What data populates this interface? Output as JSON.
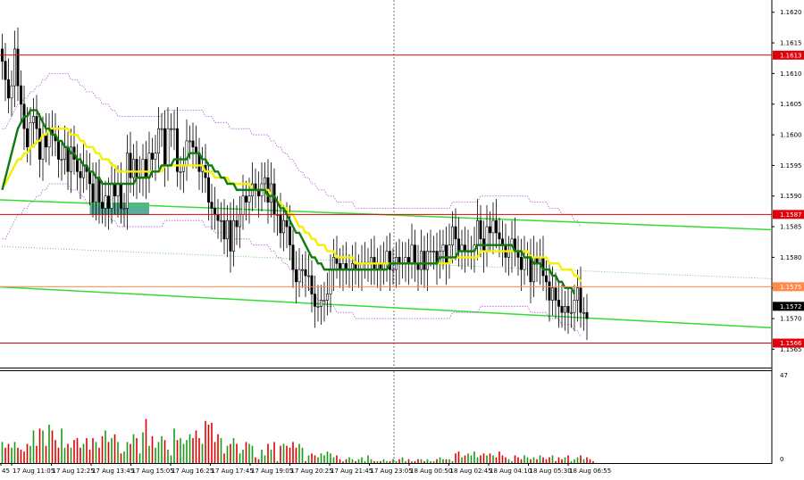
{
  "chart_data": {
    "type": "candlestick",
    "instrument_timeframe": "",
    "title": "",
    "price_axis": {
      "range": [
        1.1562,
        1.1622
      ],
      "ticks": [
        "1.1620",
        "1.1615",
        "1.1610",
        "1.1605",
        "1.1600",
        "1.1595",
        "1.1590",
        "1.1585",
        "1.1580",
        "1.1575",
        "1.1570",
        "1.1565"
      ]
    },
    "time_axis": {
      "labels": [
        "45",
        "17 Aug 11:05",
        "17 Aug 12:25",
        "17 Aug 13:45",
        "17 Aug 15:05",
        "17 Aug 16:25",
        "17 Aug 17:45",
        "17 Aug 19:05",
        "17 Aug 20:25",
        "17 Aug 21:45",
        "17 Aug 23:05",
        "18 Aug 00:50",
        "18 Aug 02:45",
        "18 Aug 04:10",
        "18 Aug 05:30",
        "18 Aug 06:55"
      ]
    },
    "horizontal_levels": [
      {
        "price": 1.1613,
        "label": "1.1613",
        "color": "#e0000a"
      },
      {
        "price": 1.1587,
        "label": "1.1587",
        "color": "#e0000a"
      },
      {
        "price": 1.15752,
        "label": "1.1575",
        "color": "#ff8a4a"
      },
      {
        "price": 1.1566,
        "label": "1.1566",
        "color": "#e0000a"
      }
    ],
    "current_price": {
      "price": 1.1572,
      "label": "1.1572"
    },
    "trend_lines": [
      {
        "name": "upper channel",
        "from": [
          1,
          1.15894
        ],
        "to": [
          191,
          1.15845
        ],
        "color": "#33dd33"
      },
      {
        "name": "lower channel",
        "from": [
          1,
          1.15752
        ],
        "to": [
          191,
          1.15685
        ],
        "color": "#33dd33"
      },
      {
        "name": "mid channel (dotted)",
        "from": [
          1,
          1.15818
        ],
        "to": [
          191,
          1.15765
        ],
        "color": "#66cc66",
        "dotted": true
      }
    ],
    "highlight_box": {
      "from_bar": 28,
      "to_bar": 47,
      "price_from": 1.15865,
      "price_to": 1.15885,
      "color": "#3aa08a"
    },
    "candles_close": [
      1.1612,
      1.1609,
      1.1606,
      1.1608,
      1.1614,
      1.1608,
      1.1605,
      1.1601,
      1.1598,
      1.1602,
      1.1603,
      1.1601,
      1.1596,
      1.16,
      1.1598,
      1.1601,
      1.16,
      1.1599,
      1.1596,
      1.1596,
      1.1598,
      1.1594,
      1.1598,
      1.1596,
      1.1594,
      1.1593,
      1.1595,
      1.1594,
      1.1592,
      1.1589,
      1.1593,
      1.1589,
      1.1588,
      1.159,
      1.1588,
      1.1592,
      1.159,
      1.1592,
      1.1588,
      1.1588,
      1.1597,
      1.1593,
      1.1596,
      1.1593,
      1.1593,
      1.1596,
      1.1593,
      1.1597,
      1.1596,
      1.1597,
      1.1601,
      1.1601,
      1.1595,
      1.1601,
      1.1601,
      1.1601,
      1.1594,
      1.1594,
      1.1595,
      1.1599,
      1.1599,
      1.1598,
      1.1597,
      1.1594,
      1.1595,
      1.1593,
      1.1589,
      1.1588,
      1.1587,
      1.1586,
      1.1586,
      1.1583,
      1.1586,
      1.1581,
      1.1586,
      1.1585,
      1.1587,
      1.159,
      1.1589,
      1.159,
      1.1592,
      1.1591,
      1.159,
      1.1592,
      1.1593,
      1.1589,
      1.1592,
      1.1587,
      1.1587,
      1.1584,
      1.1586,
      1.1585,
      1.1582,
      1.1578,
      1.1576,
      1.1578,
      1.1578,
      1.1577,
      1.1577,
      1.1574,
      1.1572,
      1.1572,
      1.1573,
      1.1573,
      1.1574,
      1.1578,
      1.158,
      1.1579,
      1.1578,
      1.1579,
      1.1578,
      1.1578,
      1.1579,
      1.1578,
      1.1578,
      1.1579,
      1.1579,
      1.1579,
      1.158,
      1.1578,
      1.1579,
      1.1578,
      1.1579,
      1.1581,
      1.1578,
      1.1578,
      1.158,
      1.1579,
      1.1579,
      1.158,
      1.1579,
      1.1582,
      1.1579,
      1.1578,
      1.1581,
      1.1578,
      1.1581,
      1.1581,
      1.1581,
      1.1579,
      1.1581,
      1.1582,
      1.1579,
      1.1582,
      1.1585,
      1.1583,
      1.1581,
      1.1582,
      1.1581,
      1.1581,
      1.1581,
      1.1582,
      1.1586,
      1.1583,
      1.1581,
      1.1585,
      1.1584,
      1.1586,
      1.1584,
      1.1583,
      1.1582,
      1.158,
      1.1581,
      1.1583,
      1.1581,
      1.158,
      1.1578,
      1.158,
      1.158,
      1.1576,
      1.158,
      1.1579,
      1.158,
      1.1577,
      1.1576,
      1.1573,
      1.1575,
      1.1573,
      1.1572,
      1.1571,
      1.1572,
      1.1571,
      1.1571,
      1.1573,
      1.1575,
      1.1571,
      1.1571,
      1.157
    ],
    "ema_green": [
      1.1591,
      1.1593,
      1.1595,
      1.1597,
      1.1599,
      1.1601,
      1.1602,
      1.1603,
      1.1603,
      1.1604,
      1.1604,
      1.1604,
      1.1603,
      1.1602,
      1.1601,
      1.1601,
      1.16,
      1.16,
      1.1599,
      1.1599,
      1.1598,
      1.1598,
      1.1597,
      1.1597,
      1.1596,
      1.1596,
      1.1595,
      1.1595,
      1.1594,
      1.1594,
      1.1593,
      1.1593,
      1.1592,
      1.1592,
      1.1592,
      1.1592,
      1.1592,
      1.1592,
      1.1592,
      1.1592,
      1.1592,
      1.1592,
      1.1592,
      1.1593,
      1.1593,
      1.1593,
      1.1593,
      1.1593,
      1.1594,
      1.1594,
      1.1594,
      1.1595,
      1.1595,
      1.1595,
      1.1595,
      1.1596,
      1.1596,
      1.1596,
      1.1596,
      1.1596,
      1.1597,
      1.1597,
      1.1597,
      1.1597,
      1.1596,
      1.1596,
      1.1595,
      1.1595,
      1.1594,
      1.1594,
      1.1593,
      1.1593,
      1.1592,
      1.1592,
      1.1592,
      1.1591,
      1.1591,
      1.1591,
      1.1591,
      1.1591,
      1.1591,
      1.1591,
      1.1591,
      1.1591,
      1.1591,
      1.159,
      1.159,
      1.159,
      1.1589,
      1.1588,
      1.1588,
      1.1587,
      1.1586,
      1.1585,
      1.1584,
      1.1584,
      1.1583,
      1.1582,
      1.1581,
      1.158,
      1.158,
      1.1579,
      1.1579,
      1.1578,
      1.1578,
      1.1578,
      1.1578,
      1.1578,
      1.1578,
      1.1578,
      1.1578,
      1.1578,
      1.1578,
      1.1578,
      1.1578,
      1.1578,
      1.1578,
      1.1578,
      1.1578,
      1.1578,
      1.1578,
      1.1578,
      1.1578,
      1.1578,
      1.1579,
      1.1579,
      1.1579,
      1.1579,
      1.1579,
      1.1579,
      1.1579,
      1.1579,
      1.1579,
      1.1579,
      1.1579,
      1.1579,
      1.1579,
      1.1579,
      1.1579,
      1.1579,
      1.158,
      1.158,
      1.158,
      1.158,
      1.158,
      1.158,
      1.1581,
      1.1581,
      1.1581,
      1.1581,
      1.1581,
      1.1581,
      1.1582,
      1.1582,
      1.1582,
      1.1582,
      1.1582,
      1.1582,
      1.1582,
      1.1582,
      1.1582,
      1.1582,
      1.1582,
      1.1582,
      1.1581,
      1.1581,
      1.1581,
      1.158,
      1.158,
      1.158,
      1.1579,
      1.1579,
      1.1579,
      1.1578,
      1.1578,
      1.1578,
      1.1577,
      1.1577,
      1.1576,
      1.1576,
      1.1575,
      1.1575,
      1.1575,
      1.1574
    ],
    "sma_yellow": [
      1.1592,
      1.1592,
      1.1593,
      1.1594,
      1.1595,
      1.1596,
      1.1596,
      1.1597,
      1.1597,
      1.1598,
      1.1598,
      1.1599,
      1.1599,
      1.16,
      1.16,
      1.1601,
      1.1601,
      1.1601,
      1.1601,
      1.1601,
      1.1601,
      1.1601,
      1.16,
      1.16,
      1.16,
      1.1599,
      1.1599,
      1.1598,
      1.1598,
      1.1598,
      1.1597,
      1.1597,
      1.1596,
      1.1596,
      1.1596,
      1.1595,
      1.1595,
      1.1594,
      1.1594,
      1.1594,
      1.1594,
      1.1594,
      1.1594,
      1.1594,
      1.1594,
      1.1594,
      1.1594,
      1.1594,
      1.1594,
      1.1594,
      1.1594,
      1.1594,
      1.1595,
      1.1595,
      1.1595,
      1.1595,
      1.1595,
      1.1595,
      1.1595,
      1.1595,
      1.1595,
      1.1595,
      1.1595,
      1.1595,
      1.1595,
      1.1594,
      1.1594,
      1.1594,
      1.1593,
      1.1593,
      1.1593,
      1.1593,
      1.1593,
      1.1592,
      1.1592,
      1.1592,
      1.1592,
      1.1592,
      1.1592,
      1.1592,
      1.1591,
      1.1591,
      1.1591,
      1.1591,
      1.1591,
      1.1591,
      1.159,
      1.159,
      1.1589,
      1.1589,
      1.1588,
      1.1588,
      1.1587,
      1.1587,
      1.1586,
      1.1585,
      1.1585,
      1.1584,
      1.1584,
      1.1583,
      1.1583,
      1.1582,
      1.1582,
      1.1582,
      1.1581,
      1.1581,
      1.1581,
      1.158,
      1.158,
      1.158,
      1.158,
      1.158,
      1.158,
      1.1579,
      1.1579,
      1.1579,
      1.1579,
      1.1579,
      1.1579,
      1.1579,
      1.1579,
      1.1579,
      1.1579,
      1.1579,
      1.1579,
      1.1579,
      1.1579,
      1.1579,
      1.1579,
      1.1579,
      1.1579,
      1.1579,
      1.1579,
      1.1579,
      1.1579,
      1.1579,
      1.1579,
      1.1579,
      1.1579,
      1.1579,
      1.1579,
      1.1579,
      1.1579,
      1.1579,
      1.158,
      1.158,
      1.158,
      1.158,
      1.158,
      1.158,
      1.158,
      1.158,
      1.158,
      1.1581,
      1.1581,
      1.1581,
      1.1581,
      1.1581,
      1.1581,
      1.1581,
      1.1581,
      1.1581,
      1.1581,
      1.1581,
      1.1581,
      1.1581,
      1.1581,
      1.1581,
      1.1581,
      1.158,
      1.158,
      1.158,
      1.158,
      1.158,
      1.158,
      1.1579,
      1.1579,
      1.1579,
      1.1579,
      1.1578,
      1.1578,
      1.1578,
      1.1578,
      1.1577,
      1.1577,
      1.1576
    ],
    "volume_axis": {
      "max": 47,
      "ticks": [
        "47",
        "0"
      ]
    },
    "volumes": [
      11,
      8,
      10,
      8,
      11,
      8,
      7,
      6,
      10,
      9,
      17,
      9,
      18,
      17,
      9,
      20,
      17,
      12,
      8,
      18,
      8,
      10,
      8,
      12,
      13,
      8,
      10,
      13,
      7,
      13,
      11,
      8,
      14,
      17,
      11,
      13,
      15,
      11,
      5,
      6,
      11,
      10,
      15,
      13,
      5,
      16,
      23,
      9,
      14,
      8,
      11,
      14,
      12,
      7,
      4,
      18,
      12,
      13,
      10,
      12,
      15,
      13,
      17,
      13,
      10,
      22,
      20,
      21,
      11,
      15,
      13,
      5,
      9,
      10,
      13,
      10,
      5,
      7,
      11,
      10,
      9,
      3,
      2,
      7,
      4,
      10,
      7,
      11,
      1,
      9,
      10,
      9,
      8,
      11,
      8,
      10,
      8,
      1,
      4,
      5,
      4,
      3,
      5,
      4,
      6,
      5,
      3,
      4,
      2,
      1,
      2,
      3,
      2,
      1,
      2,
      3,
      1,
      4,
      2,
      1,
      1,
      1,
      2,
      1,
      1,
      2,
      1,
      2,
      3,
      1,
      2,
      1,
      1,
      2,
      2,
      1,
      2,
      1,
      1,
      2,
      3,
      2,
      2,
      2,
      1,
      5,
      6,
      3,
      4,
      5,
      4,
      6,
      3,
      4,
      5,
      4,
      5,
      4,
      3,
      6,
      4,
      3,
      2,
      1,
      4,
      3,
      2,
      4,
      3,
      2,
      3,
      2,
      4,
      3,
      2,
      3,
      4,
      1,
      3,
      2,
      3,
      4,
      1,
      2,
      3,
      4,
      2,
      3,
      2,
      1
    ],
    "volume_colors": [
      "green = up bar",
      "red = down bar"
    ]
  }
}
